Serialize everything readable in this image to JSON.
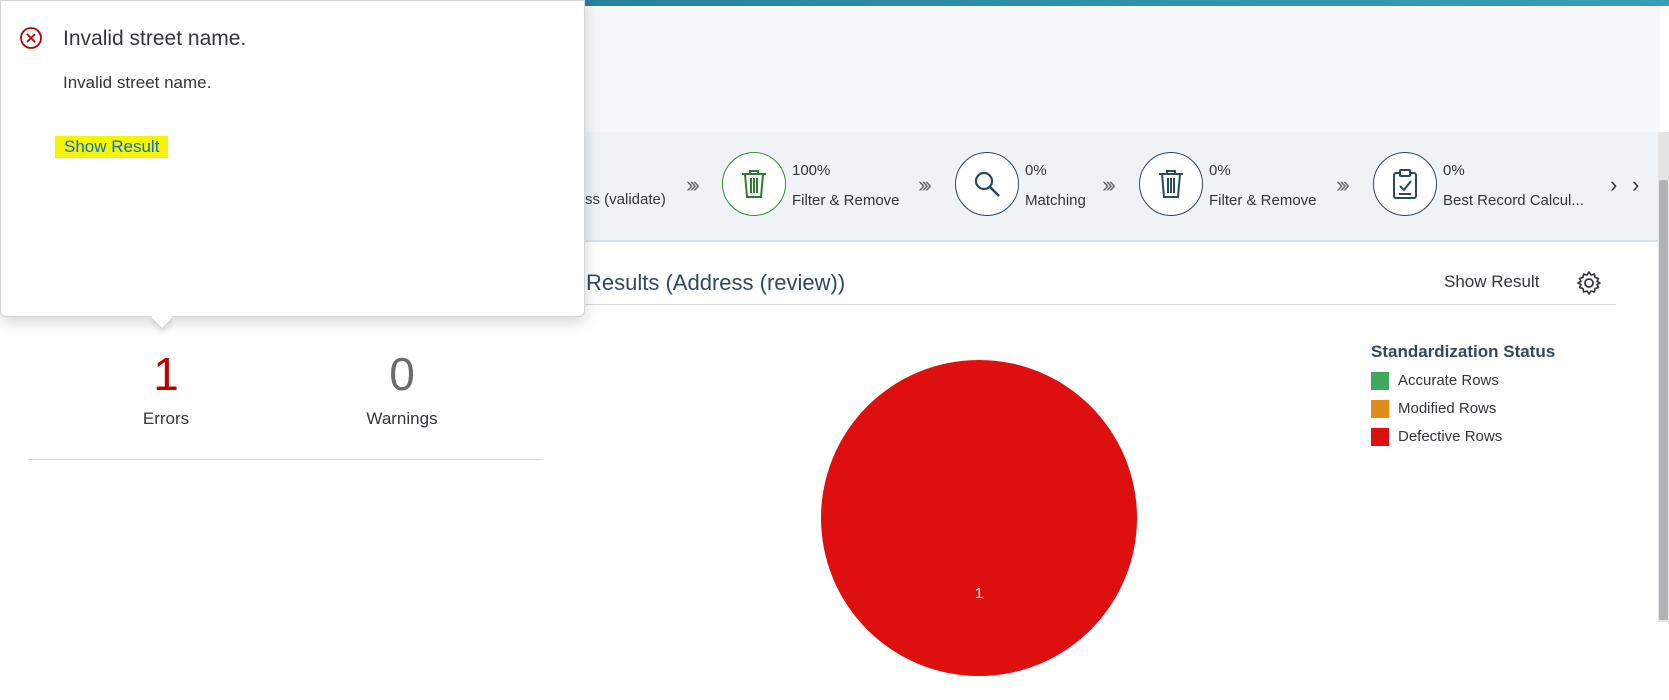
{
  "popover": {
    "title": "Invalid street name.",
    "description": "Invalid street name.",
    "link_label": "Show Result"
  },
  "steps": {
    "previous_label": "ss (validate)",
    "items": [
      {
        "percent": "100%",
        "label": "Filter & Remove",
        "icon": "trash-icon"
      },
      {
        "percent": "0%",
        "label": "Matching",
        "icon": "search-icon"
      },
      {
        "percent": "0%",
        "label": "Filter & Remove",
        "icon": "trash-icon"
      },
      {
        "percent": "0%",
        "label": "Best Record Calcul...",
        "icon": "clipboard-check-icon"
      }
    ]
  },
  "counts": {
    "errors_value": "1",
    "errors_label": "Errors",
    "warnings_value": "0",
    "warnings_label": "Warnings"
  },
  "results": {
    "title": "Results (Address (review))",
    "show_result_label": "Show Result"
  },
  "colors": {
    "error": "#bb0000",
    "accurate": "#3fa85f",
    "modified": "#e08c16",
    "defective": "#dd0f0f",
    "link": "#0a6ed1",
    "highlight": "#f5f500"
  },
  "chart_data": {
    "type": "pie",
    "title": "",
    "legend_title": "Standardization Status",
    "legend_position": "right",
    "slices": [
      {
        "name": "Accurate Rows",
        "value": 0,
        "color": "#3fa85f"
      },
      {
        "name": "Modified Rows",
        "value": 0,
        "color": "#e08c16"
      },
      {
        "name": "Defective Rows",
        "value": 1,
        "color": "#dd0f0f"
      }
    ],
    "data_labels": [
      "1"
    ]
  }
}
